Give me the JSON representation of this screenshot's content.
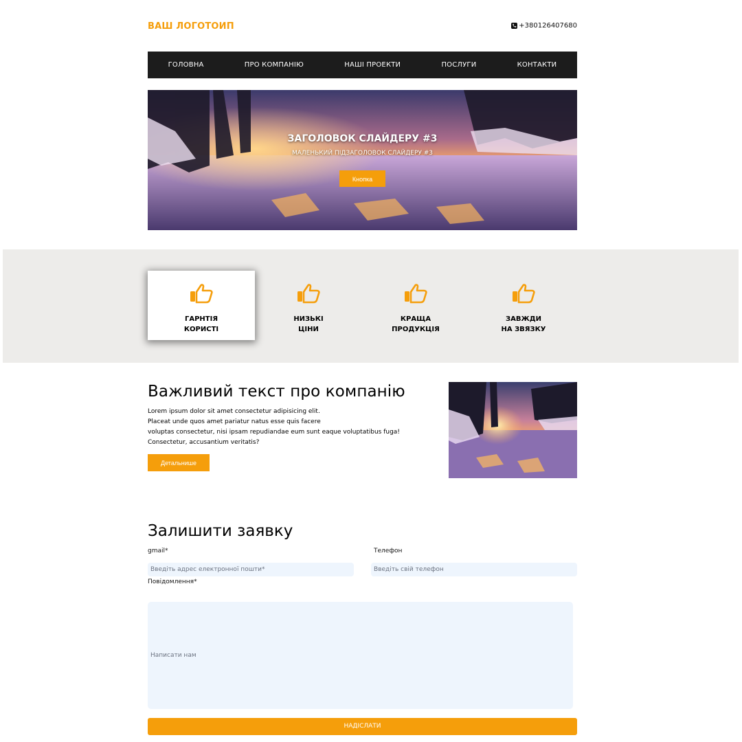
{
  "header": {
    "logo": "ВАШ ЛОГОТОИП",
    "phone": "+380126407680",
    "phone_icon": "phone-icon"
  },
  "nav": {
    "items": [
      "ГОЛОВНА",
      "ПРО КОМПАНІЮ",
      "НАШІ ПРОЕКТИ",
      "ПОСЛУГИ",
      "КОНТАКТИ"
    ]
  },
  "hero": {
    "title": "ЗАГОЛОВОК СЛАЙДЕРУ #3",
    "subtitle": "МАЛЕНЬКИЙ ПІДЗАГОЛОВОК СЛАЙДЕРУ #3",
    "button": "Кнопка"
  },
  "features": {
    "items": [
      {
        "label": "ГАРНТІЯ\nКОРИСТІ",
        "icon": "thumbs-up-icon"
      },
      {
        "label": "НИЗЬКІ\nЦІНИ",
        "icon": "thumbs-up-icon"
      },
      {
        "label": "КРАЩА\nПРОДУКЦІЯ",
        "icon": "thumbs-up-icon"
      },
      {
        "label": "ЗАВЖДИ\nНА ЗВЯЗКУ",
        "icon": "thumbs-up-icon"
      }
    ]
  },
  "about": {
    "title": "Важливий текст про компанію",
    "lines": [
      "Lorem ipsum dolor sit amet consectetur adipisicing elit.",
      "Placeat unde quos amet pariatur natus esse quis facere",
      "voluptas consectetur, nisi ipsam repudiandae eum sunt eaque voluptatibus fuga!",
      "Consectetur, accusantium veritatis?"
    ],
    "button": "Детальнише"
  },
  "form": {
    "title": "Залишити заявку",
    "email_label": "gmail*",
    "email_placeholder": "Введіть адрес електронної пошти*",
    "phone_label": "Телефон",
    "phone_placeholder": "Введіть свій телефон",
    "message_label": "Повідомлення*",
    "message_placeholder": "Написати нам",
    "submit": "НАДІСЛАТИ"
  },
  "colors": {
    "accent": "#f59e0b",
    "nav_bg": "#1c1c1c",
    "features_bg": "#edecea",
    "input_bg": "#eef5fd"
  }
}
